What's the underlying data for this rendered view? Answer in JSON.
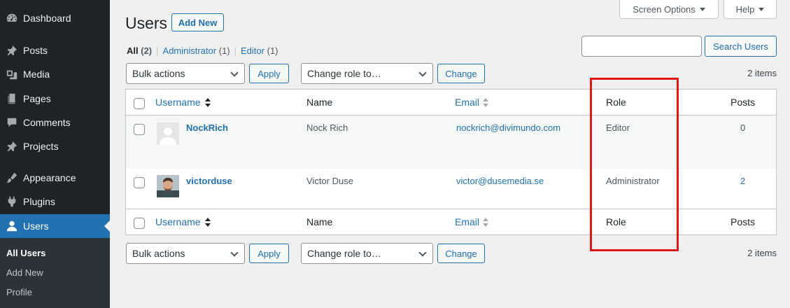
{
  "sidebar": {
    "items": [
      {
        "label": "Dashboard",
        "icon": "dashboard-icon"
      },
      {
        "label": "Posts",
        "icon": "pin-icon"
      },
      {
        "label": "Media",
        "icon": "media-icon"
      },
      {
        "label": "Pages",
        "icon": "pages-icon"
      },
      {
        "label": "Comments",
        "icon": "comment-icon"
      },
      {
        "label": "Projects",
        "icon": "pin-icon"
      },
      {
        "label": "Appearance",
        "icon": "brush-icon"
      },
      {
        "label": "Plugins",
        "icon": "plug-icon"
      },
      {
        "label": "Users",
        "icon": "user-icon"
      }
    ],
    "submenu": [
      "All Users",
      "Add New",
      "Profile"
    ]
  },
  "header": {
    "screen_options": "Screen Options",
    "help": "Help"
  },
  "page": {
    "title": "Users",
    "add_new": "Add New"
  },
  "filters": {
    "all": "All",
    "all_count": "(2)",
    "administrator": "Administrator",
    "administrator_count": "(1)",
    "editor": "Editor",
    "editor_count": "(1)",
    "separator": "|"
  },
  "search": {
    "placeholder": "",
    "button": "Search Users"
  },
  "tablenav": {
    "bulk_actions": "Bulk actions",
    "apply": "Apply",
    "change_role": "Change role to…",
    "change": "Change",
    "items": "2 items"
  },
  "table": {
    "columns": {
      "username": "Username",
      "name": "Name",
      "email": "Email",
      "role": "Role",
      "posts": "Posts"
    },
    "rows": [
      {
        "username": "NockRich",
        "name": "Nock Rich",
        "email": "nockrich@divimundo.com",
        "role": "Editor",
        "posts": "0"
      },
      {
        "username": "victorduse",
        "name": "Victor Duse",
        "email": "victor@dusemedia.se",
        "role": "Administrator",
        "posts": "2"
      }
    ]
  },
  "colors": {
    "sidebar_bg": "#1d2327",
    "accent": "#2271b1",
    "highlight": "#e11818"
  }
}
